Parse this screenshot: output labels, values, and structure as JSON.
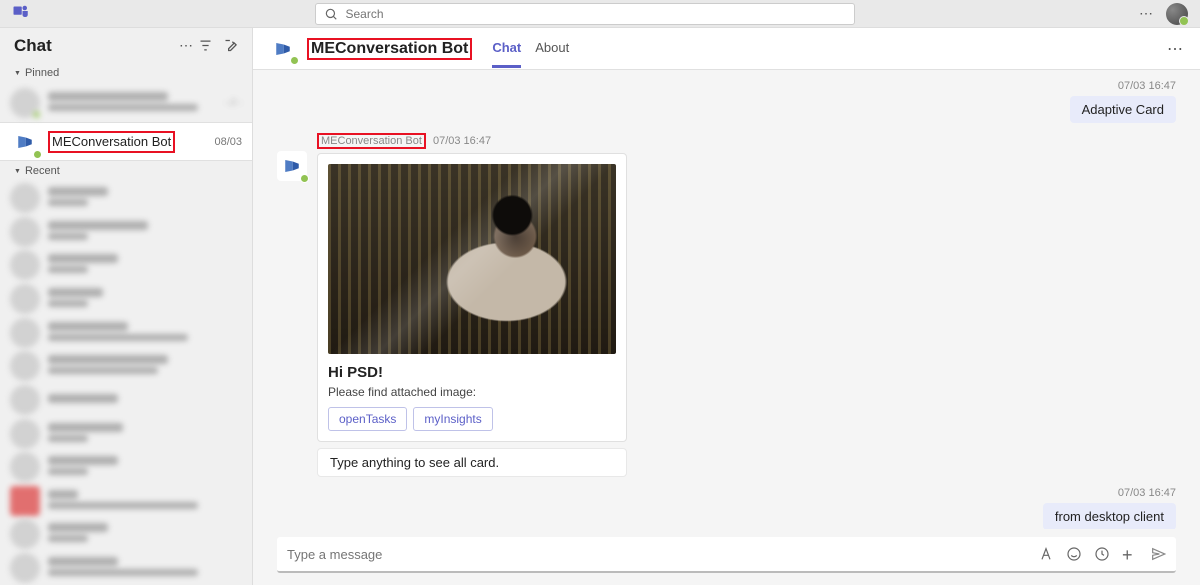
{
  "search": {
    "placeholder": "Search"
  },
  "sidebar": {
    "title": "Chat",
    "pinned_label": "Pinned",
    "recent_label": "Recent",
    "selected": {
      "name": "MEConversation Bot",
      "date": "08/03"
    }
  },
  "header": {
    "title": "MEConversation Bot",
    "tabs": {
      "chat": "Chat",
      "about": "About"
    }
  },
  "messages": {
    "m1": {
      "ts": "07/03 16:47",
      "text": "Adaptive Card"
    },
    "group": {
      "sender": "MEConversation Bot",
      "ts": "07/03 16:47",
      "card": {
        "title": "Hi PSD!",
        "body": "Please find attached image:",
        "action1": "openTasks",
        "action2": "myInsights"
      },
      "plain": "Type anything to see all card."
    },
    "m2": {
      "ts": "07/03 16:47",
      "text": "from desktop client"
    }
  },
  "composer": {
    "placeholder": "Type a message"
  }
}
